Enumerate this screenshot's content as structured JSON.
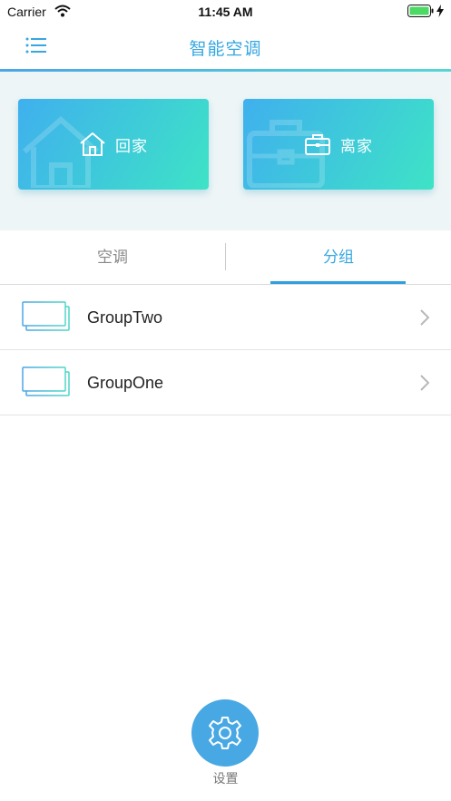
{
  "status_bar": {
    "carrier": "Carrier",
    "time": "11:45 AM"
  },
  "nav": {
    "title": "智能空调",
    "menu_icon": "list-menu-icon"
  },
  "modes": {
    "home": {
      "label": "回家",
      "icon": "house-icon"
    },
    "away": {
      "label": "离家",
      "icon": "briefcase-icon"
    }
  },
  "tabs": [
    {
      "label": "空调",
      "selected": false
    },
    {
      "label": "分组",
      "selected": true
    }
  ],
  "groups": [
    {
      "name": "GroupTwo"
    },
    {
      "name": "GroupOne"
    }
  ],
  "settings": {
    "label": "设置",
    "icon": "gear-icon"
  },
  "colors": {
    "accent": "#36a7e0",
    "card_gradient_start": "#3fb0ee",
    "card_gradient_end": "#3ee3c6"
  }
}
